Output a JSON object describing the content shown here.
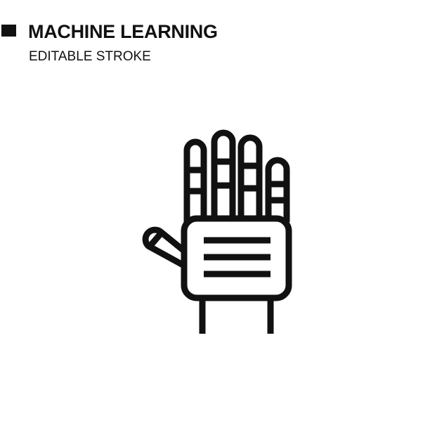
{
  "header": {
    "title": "MACHINE LEARNING",
    "subtitle": "EDITABLE STROKE"
  },
  "icon": {
    "name": "robotic-hand-icon",
    "stroke_color": "#111111",
    "background": "#ffffff"
  }
}
